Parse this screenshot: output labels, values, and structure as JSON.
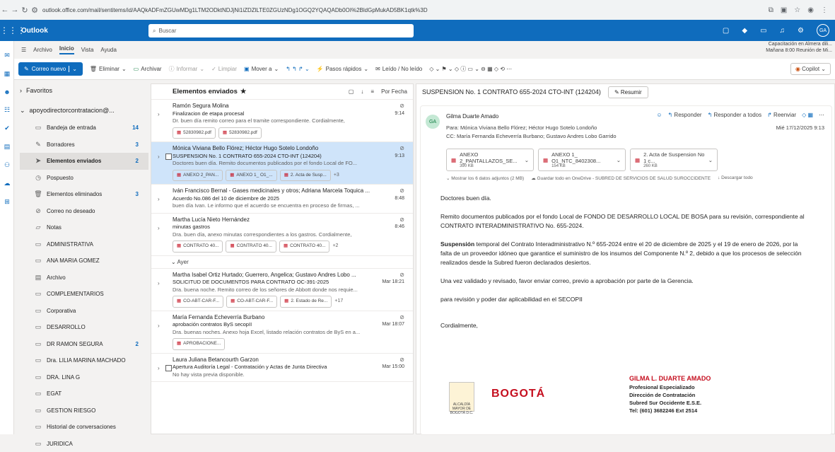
{
  "browser": {
    "url": "outlook.office.com/mail/sentitems/id/AAQkADFmZGUwMDg1LTM2ODktNDJjNi1iZDZlLTE0ZGUzNDg1OGQ2YQAQADb0OI%2BldGpMukAD5BK1qtk%3D"
  },
  "app": {
    "brand": "Outlook",
    "search_placeholder": "Buscar",
    "avatar": "GA"
  },
  "menu": [
    "Archivo",
    "Inicio",
    "Vista",
    "Ayuda"
  ],
  "ribbon": {
    "new_mail": "Correo nuevo",
    "items": [
      "Eliminar",
      "Archivar",
      "Informar",
      "Limpiar",
      "Mover a",
      "Pasos rápidos",
      "Leído / No leído"
    ],
    "copilot": "Copilot",
    "meeting_title": "Capacitación en Almera dili...",
    "meeting_time": "Mañana 8:00 Reunión de Mi..."
  },
  "folders": {
    "favorites": "Favoritos",
    "account": "apoyodirectorcontratacion@...",
    "items": [
      {
        "label": "Bandeja de entrada",
        "count": "14",
        "icon": "inbox-icon"
      },
      {
        "label": "Borradores",
        "count": "3",
        "icon": "drafts-icon"
      },
      {
        "label": "Elementos enviados",
        "count": "2",
        "icon": "sent-icon",
        "selected": true
      },
      {
        "label": "Pospuesto",
        "count": "",
        "icon": "clock-icon"
      },
      {
        "label": "Elementos eliminados",
        "count": "3",
        "icon": "trash-icon"
      },
      {
        "label": "Correo no deseado",
        "count": "",
        "icon": "junk-icon"
      },
      {
        "label": "Notas",
        "count": "",
        "icon": "notes-icon"
      },
      {
        "label": "ADMINISTRATIVA",
        "count": "",
        "icon": "folder-icon"
      },
      {
        "label": "ANA MARIA GOMEZ",
        "count": "",
        "icon": "folder-icon"
      },
      {
        "label": "Archivo",
        "count": "",
        "icon": "archive-icon"
      },
      {
        "label": "COMPLEMENTARIOS",
        "count": "",
        "icon": "folder-icon"
      },
      {
        "label": "Corporativa",
        "count": "",
        "icon": "folder-icon"
      },
      {
        "label": "DESARROLLO",
        "count": "",
        "icon": "folder-icon"
      },
      {
        "label": "DR RAMON SEGURA",
        "count": "2",
        "icon": "folder-icon"
      },
      {
        "label": "Dra. LILIA MARINA MACHADO",
        "count": "",
        "icon": "folder-icon"
      },
      {
        "label": "DRA. LINA G",
        "count": "",
        "icon": "folder-icon"
      },
      {
        "label": "EGAT",
        "count": "",
        "icon": "folder-icon"
      },
      {
        "label": "GESTION RIESGO",
        "count": "",
        "icon": "folder-icon"
      },
      {
        "label": "Historial de conversaciones",
        "count": "",
        "icon": "folder-icon"
      },
      {
        "label": "JURIDICA",
        "count": "",
        "icon": "folder-icon"
      }
    ]
  },
  "list": {
    "title": "Elementos enviados",
    "sort": "Por Fecha",
    "group_yesterday": "Ayer",
    "messages": [
      {
        "from": "Ramón Segura Molina",
        "subject": "Finalizacion de etapa procesal",
        "time": "9:14",
        "preview": "Dr. buen día remito correo para el tramite correspondiente. Cordialmente,",
        "atts": [
          "52830982.pdf",
          "52830982.pdf"
        ],
        "more": ""
      },
      {
        "from": "Mónica Viviana Bello Flórez; Héctor Hugo Sotelo Londoño",
        "subject": "SUSPENSION No. 1 CONTRATO 655-2024 CTO-INT (124204)",
        "time": "9:13",
        "preview": "Doctores buen día. Remito documentos publicados por el fondo Local de FO...",
        "atts": [
          "ANEXO 2_PAN...",
          "ANEXO 1_ O1_...",
          "2. Acta de Susp..."
        ],
        "more": "+3"
      },
      {
        "from": "Iván Francisco Bernal - Gases medicinales y otros; Adriana Marcela Toquica ...",
        "subject": "Acuerdo No.086 del 10 de diciembre de 2025",
        "time": "8:48",
        "preview": "buen día Ivan. Le informo que el acuerdo se encuentra en proceso de firmas, ...",
        "atts": [],
        "more": ""
      },
      {
        "from": "Martha Lucía Nieto Hernández",
        "subject": "minutas gastros",
        "time": "8:46",
        "preview": "Dra. buen día, anexo minutas correspondientes a los gastros. Cordialmente,",
        "atts": [
          "CONTRATO 40...",
          "CONTRATO 40...",
          "CONTRATO 40..."
        ],
        "more": "+2"
      },
      {
        "from": "Martha Isabel Ortiz Hurtado; Guerrero, Angelica; Gustavo Andres Lobo ...",
        "subject": "SOLICITUD DE DOCUMENTOS PARA CONTRATO OC-391-2025",
        "time": "Mar 18:21",
        "preview": "Dra. buena noche. Remito correo de los señores de Abbott donde nos requie...",
        "atts": [
          "CO-ABT-CAR-F...",
          "CO-ABT-CAR-F...",
          "2. Estado de Re..."
        ],
        "more": "+17"
      },
      {
        "from": "María Fernanda Echeverría Burbano",
        "subject": "aprobación contratos ByS secopII",
        "time": "Mar 18:07",
        "preview": "Dra. buenas noches. Anexo hoja Excel, listado relación contratos de ByS en a...",
        "atts": [
          "APROBACIONE..."
        ],
        "more": ""
      },
      {
        "from": "Laura Juliana Betancourth Garzon",
        "subject": "Apertura Auditoría Legal - Contratación y Actas de Junta Directiva",
        "time": "Mar 15:00",
        "preview": "No hay vista previa disponible.",
        "atts": [],
        "more": ""
      }
    ]
  },
  "reading": {
    "subject": "SUSPENSION No. 1 CONTRATO 655-2024 CTO-INT (124204)",
    "summarize": "Resumir",
    "avatar": "GA",
    "sender": "Gilma Duarte Amado",
    "reply": "Responder",
    "reply_all": "Responder a todos",
    "forward": "Reenviar",
    "to": "Para: Mónica Viviana Bello Flórez; Héctor Hugo Sotelo Londoño",
    "cc": "CC: María Fernanda Echeverría Burbano; Gustavo Andres Lobo Garrido",
    "date": "Mié 17/12/2025 9:13",
    "attachments": [
      {
        "name": "ANEXO 2_PANTALLAZOS_SE...",
        "size": "390 KB"
      },
      {
        "name": "ANEXO 1_ O1_NTC_8402308...",
        "size": "154 KB"
      },
      {
        "name": "2. Acta de Suspension No 1 c...",
        "size": "260 KB"
      }
    ],
    "show_all": "Mostrar los 6 datos adjuntos (2 MB)",
    "save_onedrive": "Guardar todo en OneDrive - SUBRED DE SERVICIOS DE SALUD SUROCCIDENTE",
    "download_all": "Descargar todo",
    "body": [
      "Doctores buen día.",
      "Remito documentos publicados por el fondo Local de FONDO DE DESARROLLO LOCAL DE BOSA para su revisión, correspondiente al CONTRATO INTERADMINISTRATIVO No. 655-2024.",
      "Suspensión",
      " temporal del Contrato Interadministrativo N.º 655-2024 entre el 20 de diciembre de 2025 y el 19 de enero de 2026, por la falta de un proveedor idóneo que garantice el suministro de los insumos del Componente N.º 2, debido a que los procesos de selección realizados desde la Subred fueron declarados desiertos.",
      "Una vez validado y revisado, favor enviar correo, previo a aprobación por parte de la Gerencia.",
      "para revisión y poder dar aplicabilidad en el SECOPII",
      "Cordialmente,"
    ],
    "signature": {
      "name": "GILMA L. DUARTE AMADO",
      "lines": [
        "Profesional Especializado",
        "Dirección de Contratación",
        "Subred Sur Occidente E.S.E.",
        "Tel: (601) 3682246 Ext 2514"
      ],
      "logo_text": "ALCALDÍA MAYOR DE BOGOTÁ D.C.",
      "bogota": "BOGOTÁ"
    }
  }
}
